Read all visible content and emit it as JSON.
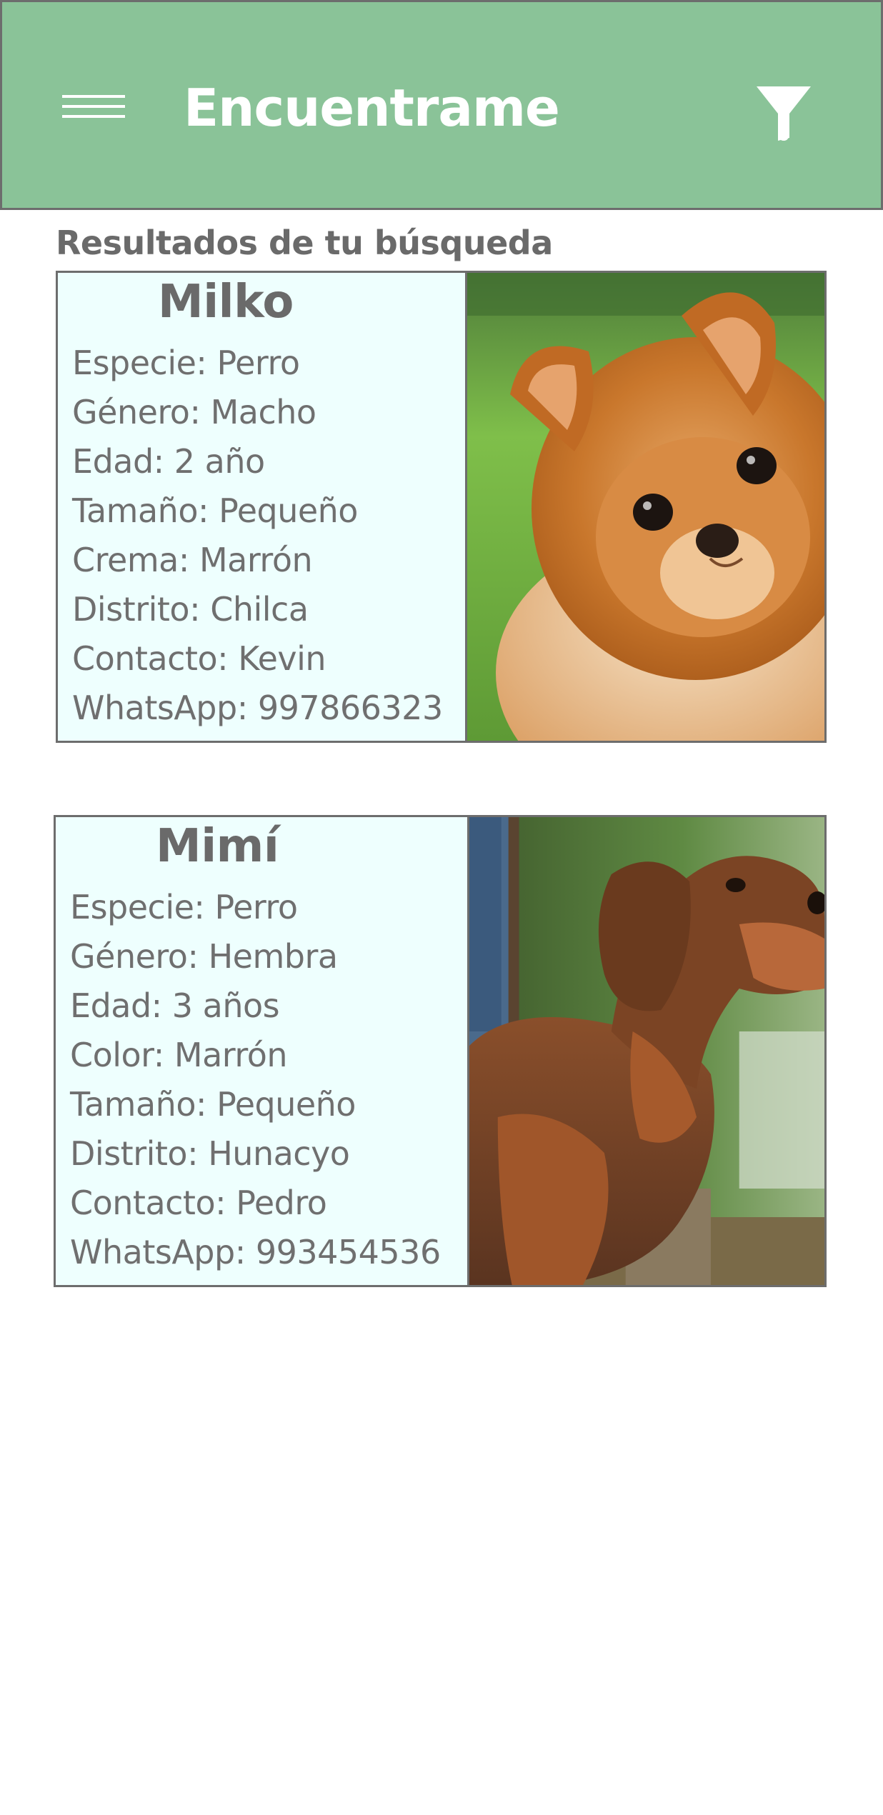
{
  "header": {
    "title": "Encuentrame",
    "menu_icon": "hamburger-menu-icon",
    "filter_icon": "filter-funnel-icon",
    "background": "#8ac398"
  },
  "results": {
    "heading": "Resultados de tu búsqueda",
    "pets": [
      {
        "name": "Milko",
        "fields": [
          "Especie: Perro",
          "Género: Macho",
          "Edad: 2 año",
          "Tamaño: Pequeño",
          "Crema: Marrón",
          "Distrito: Chilca",
          "Contacto: Kevin",
          "WhatsApp: 997866323"
        ],
        "photo": "pomeranian-photo"
      },
      {
        "name": "Mimí",
        "fields": [
          "Especie: Perro",
          "Género: Hembra",
          "Edad: 3 años",
          "Color: Marrón",
          "Tamaño: Pequeño",
          "Distrito: Hunacyo",
          "Contacto: Pedro",
          "WhatsApp: 993454536"
        ],
        "photo": "dachshund-photo"
      }
    ]
  },
  "colors": {
    "card_info_bg": "#eefffe",
    "border": "#6d6d6d",
    "text": "#6f6f6f"
  }
}
